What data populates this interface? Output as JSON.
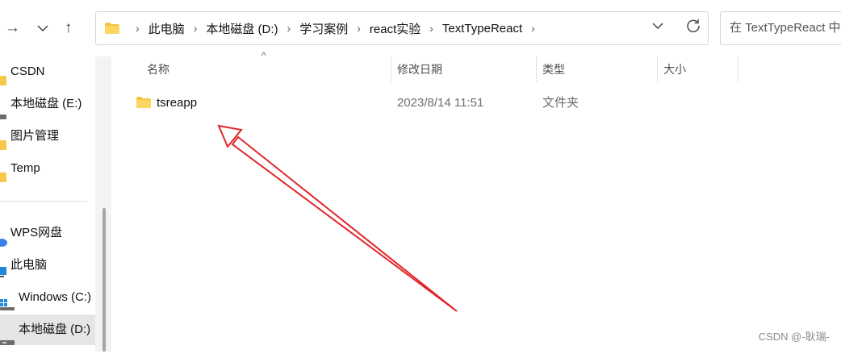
{
  "toolbar": {
    "forward_icon": "arrow-right",
    "recent_icon": "chevron-down",
    "up_icon": "arrow-up"
  },
  "address": {
    "crumbs": [
      "此电脑",
      "本地磁盘 (D:)",
      "学习案例",
      "react实验",
      "TextTypeReact"
    ],
    "search_placeholder": "在 TextTypeReact 中"
  },
  "sidebar": {
    "items": [
      {
        "label": "CSDN",
        "icon": "folder-icon"
      },
      {
        "label": "本地磁盘 (E:)",
        "icon": "drive-icon"
      },
      {
        "label": "图片管理",
        "icon": "folder-icon"
      },
      {
        "label": "Temp",
        "icon": "folder-icon"
      },
      {
        "label": "WPS网盘",
        "icon": "cloud-icon"
      },
      {
        "label": "此电脑",
        "icon": "computer-icon"
      },
      {
        "label": "Windows (C:)",
        "icon": "drive-icon"
      },
      {
        "label": "本地磁盘 (D:)",
        "icon": "drive-icon",
        "selected": true
      }
    ]
  },
  "columns": {
    "name": "名称",
    "modified": "修改日期",
    "type": "类型",
    "size": "大小"
  },
  "files": [
    {
      "name": "tsreapp",
      "modified": "2023/8/14 11:51",
      "type": "文件夹",
      "size": ""
    }
  ],
  "annotation": {
    "color": "#e0262b",
    "kind": "red-arrow"
  },
  "watermark": "CSDN @-耿瑞-"
}
